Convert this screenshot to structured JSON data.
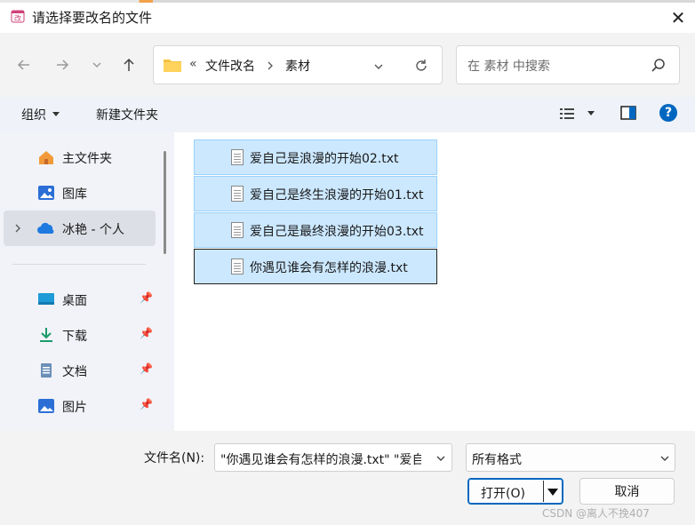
{
  "window": {
    "title": "请选择要改名的文件",
    "close_label": "✕"
  },
  "breadcrumb": {
    "overflow": "«",
    "segments": [
      "文件改名",
      "素材"
    ]
  },
  "search": {
    "placeholder": "在 素材 中搜索"
  },
  "toolbar": {
    "organize": "组织",
    "new_folder": "新建文件夹",
    "help": "?"
  },
  "sidebar": {
    "items": [
      {
        "label": "主文件夹",
        "icon": "home-icon"
      },
      {
        "label": "图库",
        "icon": "gallery-icon"
      },
      {
        "label": "冰艳 - 个人",
        "icon": "onedrive-cloud-icon"
      },
      {
        "label": "桌面",
        "icon": "desktop-icon"
      },
      {
        "label": "下载",
        "icon": "download-icon"
      },
      {
        "label": "文档",
        "icon": "document-icon"
      },
      {
        "label": "图片",
        "icon": "pictures-icon"
      }
    ]
  },
  "files": [
    {
      "name": "爱自己是浪漫的开始02.txt"
    },
    {
      "name": "爱自己是终生浪漫的开始01.txt"
    },
    {
      "name": "爱自己是最终浪漫的开始03.txt"
    },
    {
      "name": "你遇见谁会有怎样的浪漫.txt"
    }
  ],
  "bottom": {
    "filename_label": "文件名(N):",
    "filename_value": "\"你遇见谁会有怎样的浪漫.txt\" \"爱自",
    "filter_value": "所有格式",
    "open_label": "打开(O)",
    "cancel_label": "取消"
  },
  "watermark": "CSDN @离人不挽407",
  "colors": {
    "selection": "#cce8ff",
    "selection_border": "#99d1ff",
    "accent": "#0067c0"
  }
}
